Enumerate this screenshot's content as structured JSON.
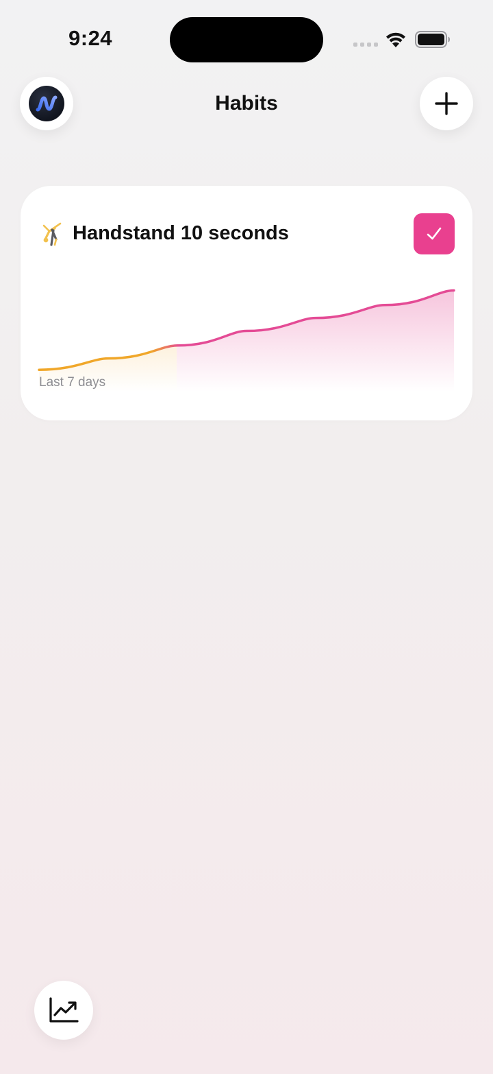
{
  "status_bar": {
    "time": "9:24"
  },
  "header": {
    "title": "Habits",
    "logo_icon": "app-logo-icon",
    "add_icon": "plus-icon"
  },
  "habits": [
    {
      "emoji": "🤸",
      "title": "Handstand 10 seconds",
      "completed": true,
      "check_color": "#e9408f",
      "chart_caption": "Last 7 days"
    }
  ],
  "chart_data": {
    "type": "area",
    "x": [
      0,
      1,
      2,
      3,
      4,
      5,
      6
    ],
    "values": [
      0.5,
      1.2,
      2.0,
      2.9,
      3.7,
      4.5,
      5.4
    ],
    "highlight_segment_end": 2,
    "colors": {
      "highlight": "#f0a72a",
      "main": "#e44b95"
    }
  },
  "footer": {
    "stats_icon": "trend-chart-icon"
  }
}
